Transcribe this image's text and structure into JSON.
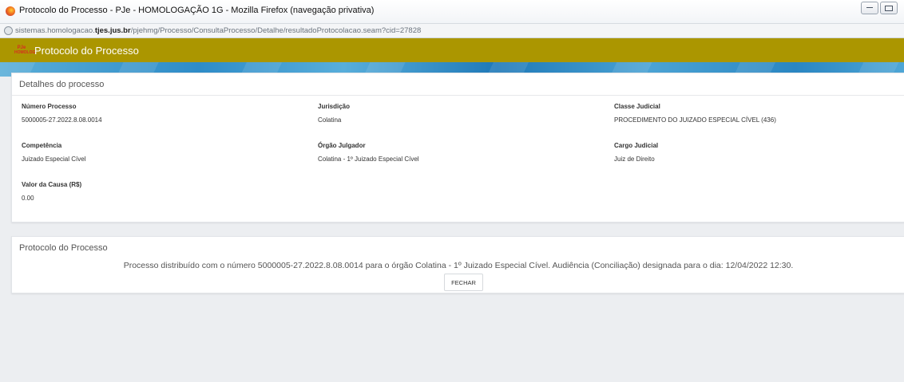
{
  "browser": {
    "window_title": "Protocolo do Processo - PJe - HOMOLOGAÇÃO 1G - Mozilla Firefox (navegação privativa)",
    "url_prefix": "sistemas.homologacao.",
    "url_domain": "tjes.jus.br",
    "url_path": "/pjehmg/Processo/ConsultaProcesso/Detalhe/resultadoProtocolacao.seam?cid=27828"
  },
  "header": {
    "logo_text_top": "PJe",
    "logo_text_bottom": "HOMOLOG",
    "title": "Protocolo do Processo",
    "bar_color": "#ab9600"
  },
  "details": {
    "title": "Detalhes do processo",
    "fields": [
      {
        "label": "Número Processo",
        "value": "5000005-27.2022.8.08.0014"
      },
      {
        "label": "Jurisdição",
        "value": "Colatina"
      },
      {
        "label": "Classe Judicial",
        "value": "PROCEDIMENTO DO JUIZADO ESPECIAL CÍVEL (436)"
      },
      {
        "label": "Competência",
        "value": "Juizado Especial Cível"
      },
      {
        "label": "Órgão Julgador",
        "value": "Colatina - 1º Juizado Especial Cível"
      },
      {
        "label": "Cargo Judicial",
        "value": "Juiz de Direito"
      },
      {
        "label": "Valor da Causa (R$)",
        "value": "0.00"
      }
    ]
  },
  "protocol": {
    "title": "Protocolo do Processo",
    "message": "Processo distribuído com o número 5000005-27.2022.8.08.0014 para o órgão Colatina - 1º Juizado Especial Cível. Audiência (Conciliação) designada para o dia: 12/04/2022 12:30.",
    "close_label": "FECHAR"
  }
}
